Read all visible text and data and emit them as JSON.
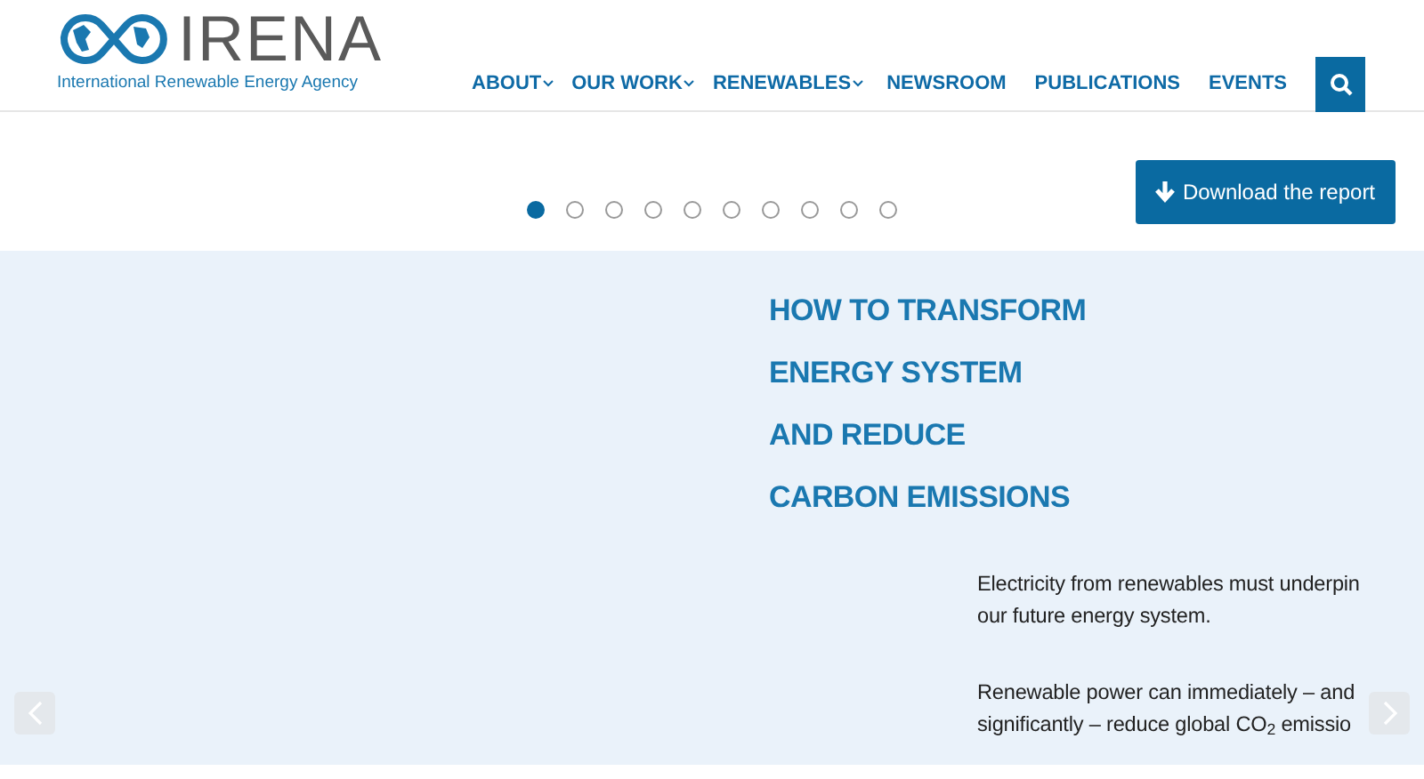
{
  "logo": {
    "name": "IRENA",
    "tagline": "International Renewable Energy Agency"
  },
  "nav": [
    {
      "label": "ABOUT",
      "dropdown": true
    },
    {
      "label": "OUR WORK",
      "dropdown": true
    },
    {
      "label": "RENEWABLES",
      "dropdown": true
    },
    {
      "label": "NEWSROOM",
      "dropdown": false
    },
    {
      "label": "PUBLICATIONS",
      "dropdown": false
    },
    {
      "label": "EVENTS",
      "dropdown": false
    }
  ],
  "download_button": "Download the report",
  "slides": [
    {
      "selected": true
    },
    {
      "selected": false
    },
    {
      "selected": false
    },
    {
      "selected": false
    },
    {
      "selected": false
    },
    {
      "selected": false
    },
    {
      "selected": false
    },
    {
      "selected": false
    },
    {
      "selected": false
    },
    {
      "selected": false
    }
  ],
  "heading": [
    "HOW TO TRANSFORM",
    "ENERGY SYSTEM",
    "AND REDUCE",
    "CARBON EMISSIONS"
  ],
  "paragraphs": [
    [
      "Electricity from renewables must underpin",
      "our future energy system."
    ],
    [
      "Renewable power can immediately – and",
      "significantly – reduce global CO$_{2}$ emissio"
    ]
  ]
}
